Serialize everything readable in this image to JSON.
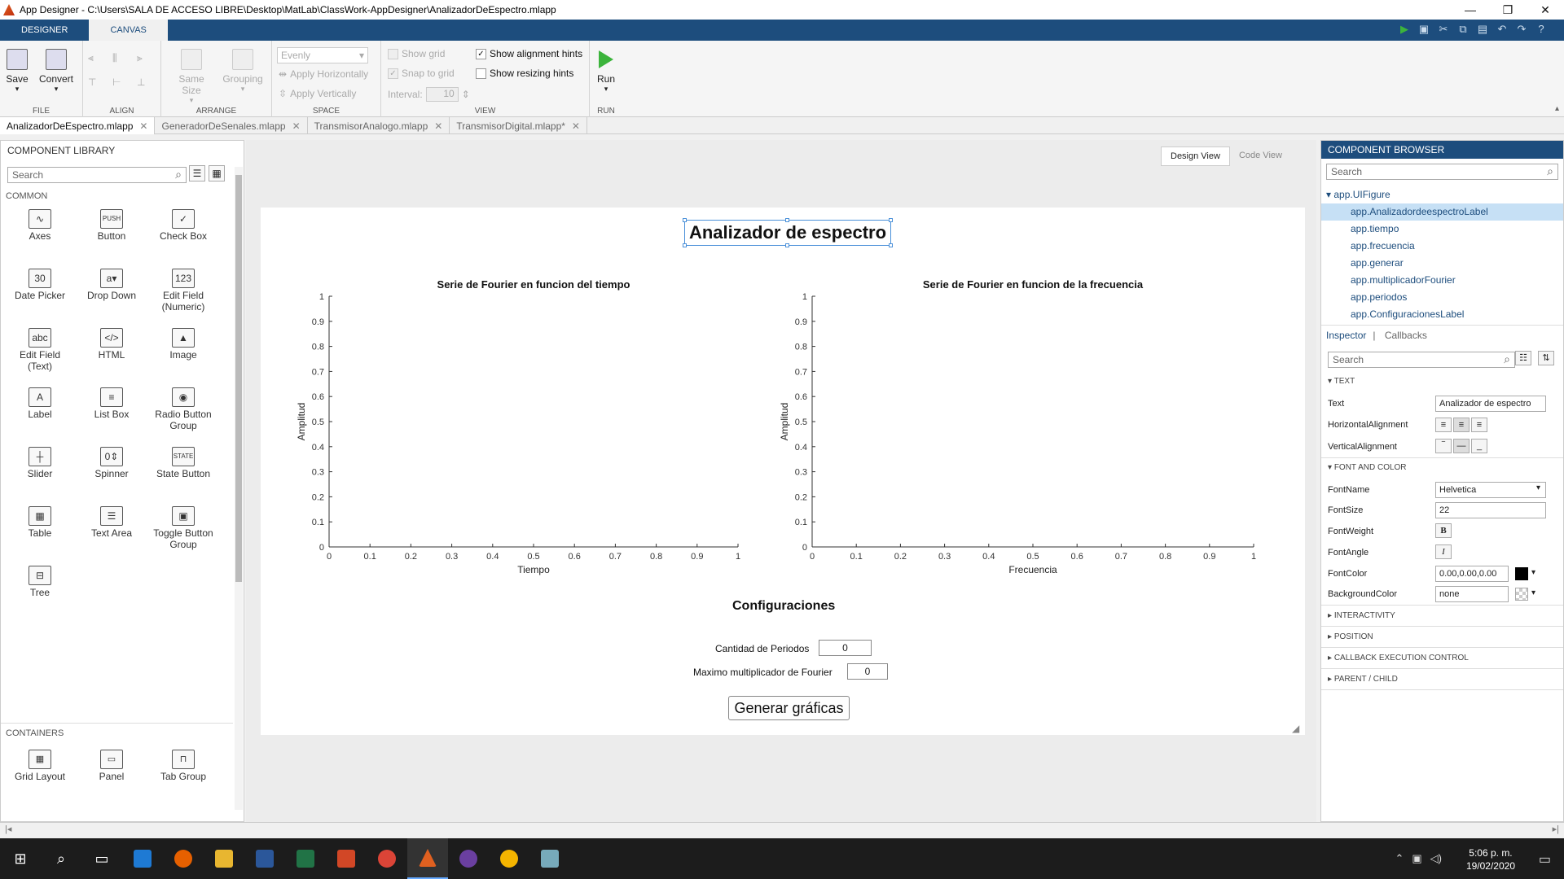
{
  "window": {
    "title": "App Designer - C:\\Users\\SALA DE ACCESO LIBRE\\Desktop\\MatLab\\ClassWork-AppDesigner\\AnalizadorDeEspectro.mlapp",
    "minimize": "—",
    "maximize": "❐",
    "close": "✕"
  },
  "tabs": {
    "designer": "DESIGNER",
    "canvas": "CANVAS"
  },
  "quick_access": [
    "run-icon",
    "save-icon",
    "cut-icon",
    "copy-icon",
    "paste-icon",
    "undo-icon",
    "redo-icon",
    "help-icon"
  ],
  "ribbon": {
    "file": {
      "label": "FILE",
      "save": "Save",
      "convert": "Convert"
    },
    "align": {
      "label": "ALIGN"
    },
    "arrange": {
      "label": "ARRANGE",
      "same_size": "Same Size",
      "grouping": "Grouping"
    },
    "space": {
      "label": "SPACE",
      "dropdown": "Evenly",
      "apply_h": "Apply Horizontally",
      "apply_v": "Apply Vertically"
    },
    "view": {
      "label": "VIEW",
      "show_grid": "Show grid",
      "snap_grid": "Snap to grid",
      "interval_label": "Interval:",
      "interval": "10",
      "show_align": "Show alignment hints",
      "show_resize": "Show resizing hints"
    },
    "run": {
      "label": "RUN",
      "run": "Run"
    }
  },
  "file_tabs": [
    {
      "name": "AnalizadorDeEspectro.mlapp",
      "active": true
    },
    {
      "name": "GeneradorDeSenales.mlapp",
      "active": false
    },
    {
      "name": "TransmisorAnalogo.mlapp",
      "active": false
    },
    {
      "name": "TransmisorDigital.mlapp*",
      "active": false
    }
  ],
  "component_library": {
    "title": "COMPONENT LIBRARY",
    "search_placeholder": "Search",
    "common_label": "COMMON",
    "containers_label": "CONTAINERS",
    "items": [
      {
        "label": "Axes",
        "glyph": "∿"
      },
      {
        "label": "Button",
        "glyph": "PUSH"
      },
      {
        "label": "Check Box",
        "glyph": "✓"
      },
      {
        "label": "Date Picker",
        "glyph": "30"
      },
      {
        "label": "Drop Down",
        "glyph": "a▾"
      },
      {
        "label": "Edit Field\n(Numeric)",
        "glyph": "123"
      },
      {
        "label": "Edit Field\n(Text)",
        "glyph": "abc"
      },
      {
        "label": "HTML",
        "glyph": "</>"
      },
      {
        "label": "Image",
        "glyph": "▲"
      },
      {
        "label": "Label",
        "glyph": "A"
      },
      {
        "label": "List Box",
        "glyph": "≡"
      },
      {
        "label": "Radio Button\nGroup",
        "glyph": "◉"
      },
      {
        "label": "Slider",
        "glyph": "┼"
      },
      {
        "label": "Spinner",
        "glyph": "0⇕"
      },
      {
        "label": "State Button",
        "glyph": "STATE"
      },
      {
        "label": "Table",
        "glyph": "▦"
      },
      {
        "label": "Text Area",
        "glyph": "☰"
      },
      {
        "label": "Toggle Button\nGroup",
        "glyph": "▣"
      },
      {
        "label": "Tree",
        "glyph": "⊟"
      }
    ],
    "containers": [
      {
        "label": "Grid Layout",
        "glyph": "▦"
      },
      {
        "label": "Panel",
        "glyph": "▭"
      },
      {
        "label": "Tab Group",
        "glyph": "⊓"
      }
    ]
  },
  "view_switch": {
    "design": "Design View",
    "code": "Code View"
  },
  "app": {
    "title": "Analizador de espectro",
    "axes1": {
      "title": "Serie de Fourier en funcion del tiempo",
      "xlabel": "Tiempo",
      "ylabel": "Amplitud"
    },
    "axes2": {
      "title": "Serie de Fourier en funcion de la frecuencia",
      "xlabel": "Frecuencia",
      "ylabel": "Amplitud"
    },
    "config_title": "Configuraciones",
    "periodos_label": "Cantidad de Periodos",
    "periodos_value": "0",
    "fourier_label": "Maximo multiplicador de Fourier",
    "fourier_value": "0",
    "generate_button": "Generar gráficas"
  },
  "chart_data": [
    {
      "type": "line",
      "title": "Serie de Fourier en funcion del tiempo",
      "xlabel": "Tiempo",
      "ylabel": "Amplitud",
      "xlim": [
        0,
        1
      ],
      "ylim": [
        0,
        1
      ],
      "xticks": [
        "0",
        "0.1",
        "0.2",
        "0.3",
        "0.4",
        "0.5",
        "0.6",
        "0.7",
        "0.8",
        "0.9",
        "1"
      ],
      "yticks": [
        "0",
        "0.1",
        "0.2",
        "0.3",
        "0.4",
        "0.5",
        "0.6",
        "0.7",
        "0.8",
        "0.9",
        "1"
      ],
      "series": []
    },
    {
      "type": "line",
      "title": "Serie de Fourier en funcion de la frecuencia",
      "xlabel": "Frecuencia",
      "ylabel": "Amplitud",
      "xlim": [
        0,
        1
      ],
      "ylim": [
        0,
        1
      ],
      "xticks": [
        "0",
        "0.1",
        "0.2",
        "0.3",
        "0.4",
        "0.5",
        "0.6",
        "0.7",
        "0.8",
        "0.9",
        "1"
      ],
      "yticks": [
        "0",
        "0.1",
        "0.2",
        "0.3",
        "0.4",
        "0.5",
        "0.6",
        "0.7",
        "0.8",
        "0.9",
        "1"
      ],
      "series": []
    }
  ],
  "component_browser": {
    "title": "COMPONENT BROWSER",
    "search_placeholder": "Search",
    "root": "app.UIFigure",
    "nodes": [
      "app.AnalizadordeespectroLabel",
      "app.tiempo",
      "app.frecuencia",
      "app.generar",
      "app.multiplicadorFourier",
      "app.periodos",
      "app.ConfiguracionesLabel"
    ],
    "selected_index": 0,
    "inspector_tab": "Inspector",
    "callbacks_tab": "Callbacks",
    "inspector_search": "Search",
    "sections": {
      "text": "TEXT",
      "font_color": "FONT AND COLOR",
      "interactivity": "INTERACTIVITY",
      "position": "POSITION",
      "callback": "CALLBACK EXECUTION CONTROL",
      "parent": "PARENT / CHILD"
    },
    "props": {
      "text_label": "Text",
      "text_value": "Analizador de espectro",
      "halign_label": "HorizontalAlignment",
      "valign_label": "VerticalAlignment",
      "fontname_label": "FontName",
      "fontname_value": "Helvetica",
      "fontsize_label": "FontSize",
      "fontsize_value": "22",
      "fontweight_label": "FontWeight",
      "fontweight_value": "B",
      "fontangle_label": "FontAngle",
      "fontangle_value": "I",
      "fontcolor_label": "FontColor",
      "fontcolor_value": "0.00,0.00,0.00",
      "bgcolor_label": "BackgroundColor",
      "bgcolor_value": "none"
    }
  },
  "taskbar": {
    "time": "5:06 p. m.",
    "date": "19/02/2020"
  },
  "colors": {
    "accent": "#1d4d7d",
    "selection": "#4a90d9",
    "run": "#3cb43c"
  }
}
